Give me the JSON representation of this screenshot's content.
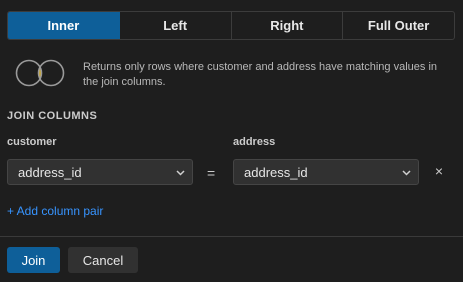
{
  "join_types": [
    {
      "label": "Inner",
      "active": true
    },
    {
      "label": "Left",
      "active": false
    },
    {
      "label": "Right",
      "active": false
    },
    {
      "label": "Full Outer",
      "active": false
    }
  ],
  "description": "Returns only rows where customer and address have matching values in the join columns.",
  "section_title": "JOIN COLUMNS",
  "left_table": "customer",
  "right_table": "address",
  "left_column": "address_id",
  "right_column": "address_id",
  "equals": "=",
  "remove_symbol": "×",
  "add_pair_label": "+ Add column pair",
  "buttons": {
    "join": "Join",
    "cancel": "Cancel"
  },
  "colors": {
    "accent": "#0e5f99",
    "link": "#3794ff",
    "venn_fill": "#d8ad1a"
  },
  "icons": {
    "venn": "venn-inner-icon",
    "chevron": "chevron-down-icon",
    "close": "close-icon"
  }
}
